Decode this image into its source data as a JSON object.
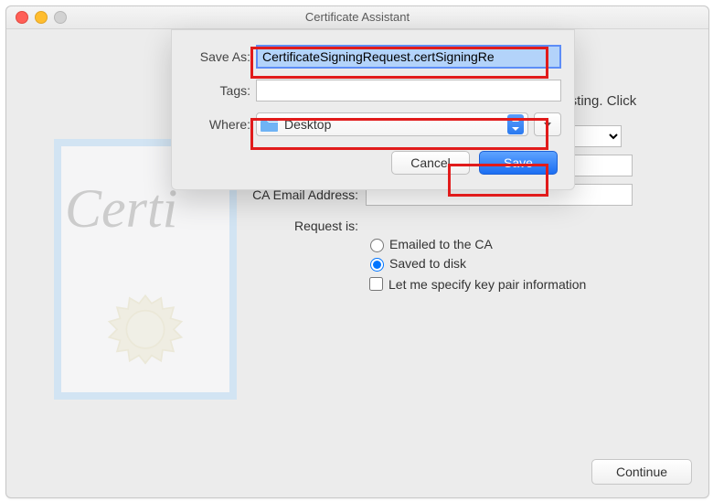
{
  "window": {
    "title": "Certificate Assistant",
    "truncated_hint": "uesting. Click"
  },
  "illustration": {
    "script_text": "Certi"
  },
  "sheet": {
    "saveas_label": "Save As:",
    "saveas_value": "CertificateSigningRequest.certSigningRe",
    "tags_label": "Tags:",
    "tags_value": "",
    "where_label": "Where:",
    "where_value": "Desktop",
    "cancel_label": "Cancel",
    "save_label": "Save"
  },
  "form": {
    "dropdown_value": "",
    "textfield_value": "",
    "ca_email_label": "CA Email Address:",
    "ca_email_value": "",
    "request_is_label": "Request is:",
    "radio_emailed_label": "Emailed to the CA",
    "radio_saved_label": "Saved to disk",
    "checkbox_keypair_label": "Let me specify key pair information",
    "radio_selected": "saved"
  },
  "footer": {
    "continue_label": "Continue"
  }
}
